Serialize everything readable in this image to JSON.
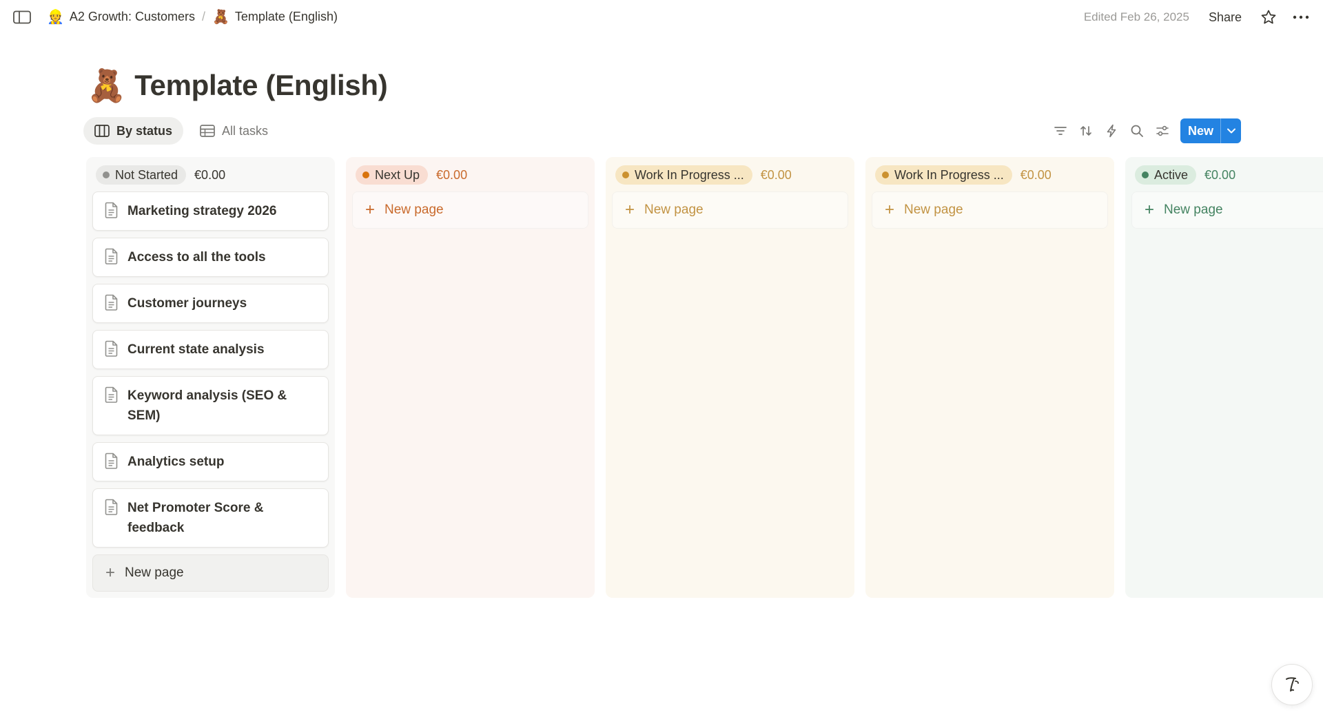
{
  "breadcrumb": [
    {
      "emoji": "👷",
      "label": "A2 Growth: Customers"
    },
    {
      "emoji": "🧸",
      "label": "Template (English)"
    }
  ],
  "breadcrumb_separator": "/",
  "topbar": {
    "edited": "Edited Feb 26, 2025",
    "share": "Share"
  },
  "page": {
    "emoji": "🧸",
    "title": "Template (English)"
  },
  "views": [
    {
      "label": "By status",
      "icon": "board-icon",
      "active": true
    },
    {
      "label": "All tasks",
      "icon": "table-icon",
      "active": false
    }
  ],
  "toolbar": {
    "icons": [
      "filter-icon",
      "sort-icon",
      "automation-icon",
      "search-icon",
      "settings-icon"
    ],
    "new_label": "New"
  },
  "columns": [
    {
      "status": "Not Started",
      "sum": "€0.00",
      "colors": {
        "bg": "#f8f8f7",
        "pill": "#e9e9e7",
        "dot": "#91918e",
        "text": "#37352f",
        "accent": "#37352f"
      },
      "cards": [
        "Marketing strategy  2026",
        "Access to all the tools",
        "Customer journeys",
        "Current state analysis",
        "Keyword analysis (SEO & SEM)",
        "Analytics setup",
        "Net Promoter Score & feedback"
      ],
      "new_page": "New page"
    },
    {
      "status": "Next Up",
      "sum": "€0.00",
      "colors": {
        "bg": "#fcf5f2",
        "pill": "#f9ddd2",
        "dot": "#d9730d",
        "text": "#37352f",
        "accent": "#c96a2c"
      },
      "cards": [],
      "new_page": "New page"
    },
    {
      "status": "Work In Progress ...",
      "sum": "€0.00",
      "colors": {
        "bg": "#fcf8ef",
        "pill": "#f7e6c2",
        "dot": "#cb912f",
        "text": "#37352f",
        "accent": "#c29343"
      },
      "cards": [],
      "new_page": "New page"
    },
    {
      "status": "Work In Progress ...",
      "sum": "€0.00",
      "colors": {
        "bg": "#fcf8ef",
        "pill": "#f7e6c2",
        "dot": "#cb912f",
        "text": "#37352f",
        "accent": "#c29343"
      },
      "cards": [],
      "new_page": "New page"
    },
    {
      "status": "Active",
      "sum": "€0.00",
      "colors": {
        "bg": "#f4f8f5",
        "pill": "#dbecdf",
        "dot": "#448361",
        "text": "#37352f",
        "accent": "#448361"
      },
      "cards": [],
      "new_page": "New page"
    }
  ]
}
